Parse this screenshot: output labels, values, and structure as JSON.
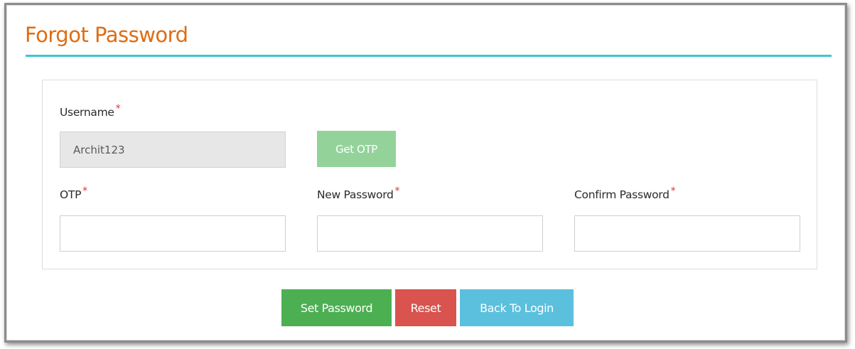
{
  "page": {
    "title": "Forgot Password"
  },
  "form": {
    "required_marker": "*",
    "username": {
      "label": "Username",
      "value": "Archit123",
      "disabled": true
    },
    "get_otp_label": "Get OTP",
    "otp": {
      "label": "OTP",
      "value": ""
    },
    "new_password": {
      "label": "New Password",
      "value": ""
    },
    "confirm_password": {
      "label": "Confirm Password",
      "value": ""
    }
  },
  "actions": {
    "set_password_label": "Set Password",
    "reset_label": "Reset",
    "back_to_login_label": "Back To Login"
  },
  "colors": {
    "title": "#e06c12",
    "title_rule": "#3cc6d2",
    "required": "#e8303a",
    "get_otp": "#93d39a",
    "set_password": "#4caf52",
    "reset": "#d9534f",
    "back_to_login": "#5bc0de"
  }
}
